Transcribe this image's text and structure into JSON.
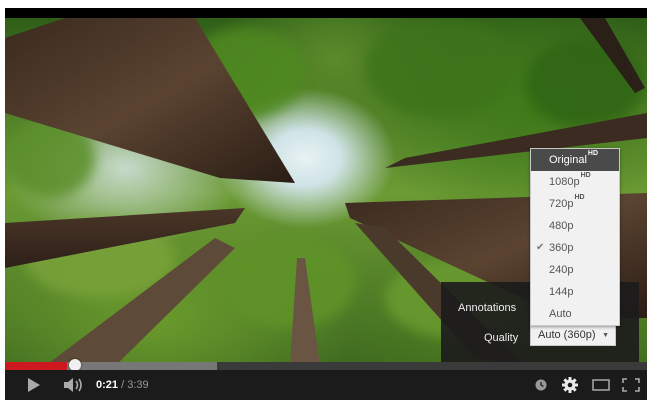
{
  "quality_menu": {
    "items": [
      {
        "label": "Original",
        "badge": "HD",
        "highlighted": true,
        "selected": false
      },
      {
        "label": "1080p",
        "badge": "HD",
        "highlighted": false,
        "selected": false
      },
      {
        "label": "720p",
        "badge": "HD",
        "highlighted": false,
        "selected": false
      },
      {
        "label": "480p",
        "badge": "",
        "highlighted": false,
        "selected": false
      },
      {
        "label": "360p",
        "badge": "",
        "highlighted": false,
        "selected": true
      },
      {
        "label": "240p",
        "badge": "",
        "highlighted": false,
        "selected": false
      },
      {
        "label": "144p",
        "badge": "",
        "highlighted": false,
        "selected": false
      },
      {
        "label": "Auto",
        "badge": "",
        "highlighted": false,
        "selected": false
      }
    ],
    "check_icon": "check-icon"
  },
  "settings": {
    "annotations_label": "Annotations",
    "quality_label": "Quality",
    "quality_value": "Auto (360p)"
  },
  "playback": {
    "current_time": "0:21",
    "separator": "/",
    "duration": "3:39",
    "played_fraction": 0.096,
    "loaded_fraction": 0.33
  },
  "colors": {
    "progress_played": "#cc181e",
    "menu_highlight": "#4a4a4a",
    "control_bar": "#1b1b1b"
  },
  "icons": {
    "play": "play-icon",
    "volume": "volume-icon",
    "watch_later": "watch-later-icon",
    "settings": "gear-icon",
    "theater": "theater-mode-icon",
    "fullscreen": "fullscreen-icon"
  }
}
